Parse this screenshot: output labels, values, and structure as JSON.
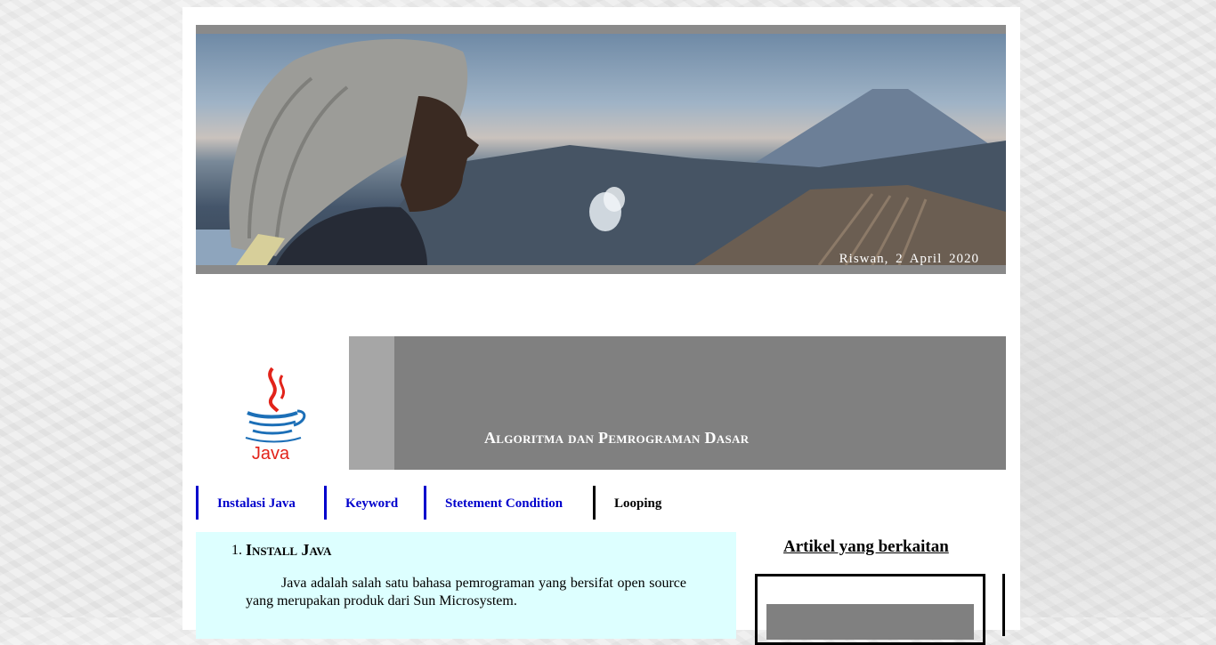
{
  "banner": {
    "caption": "Riswan,  2  April  2020"
  },
  "header": {
    "logo_text": "Java",
    "title": "Algoritma dan Pemrograman Dasar"
  },
  "nav": {
    "items": [
      {
        "label": "Instalasi Java"
      },
      {
        "label": "Keyword"
      },
      {
        "label": "Stetement Condition"
      },
      {
        "label": "Looping"
      }
    ]
  },
  "content": {
    "number": "1.",
    "heading": "Install Java",
    "paragraph": "Java adalah salah satu bahasa pemrograman yang bersifat open source yang merupakan produk dari Sun Microsystem."
  },
  "sidebar": {
    "title": "Artikel yang berkaitan"
  },
  "colors": {
    "nav_link": "#0000cc",
    "content_bg": "#ddffff",
    "header_gray": "#808080"
  }
}
